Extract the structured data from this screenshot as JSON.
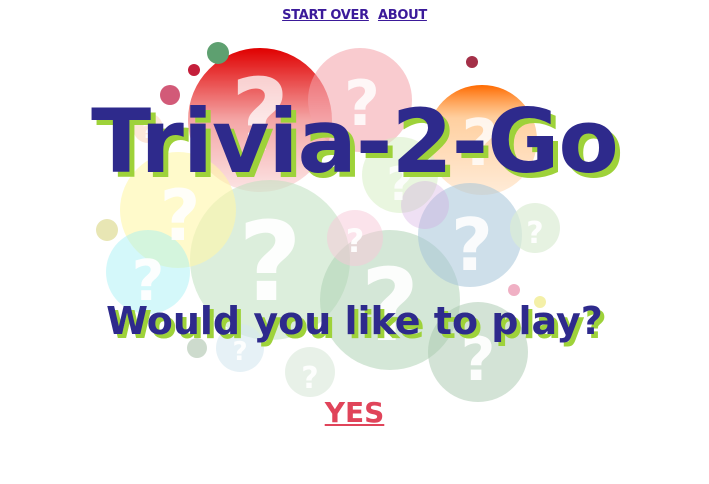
{
  "nav": {
    "links": [
      "START OVER",
      "ABOUT"
    ]
  },
  "title": "Trivia-2-Go",
  "prompt": "Would you like to play?",
  "yes_label": "YES",
  "colors": {
    "title_text": "#2e2a8c",
    "title_shadow": "#9ed23a",
    "nav_link": "#3b1a9a",
    "yes_link": "#e0445a"
  },
  "icons": [
    "question-mark-bubble-icon"
  ]
}
